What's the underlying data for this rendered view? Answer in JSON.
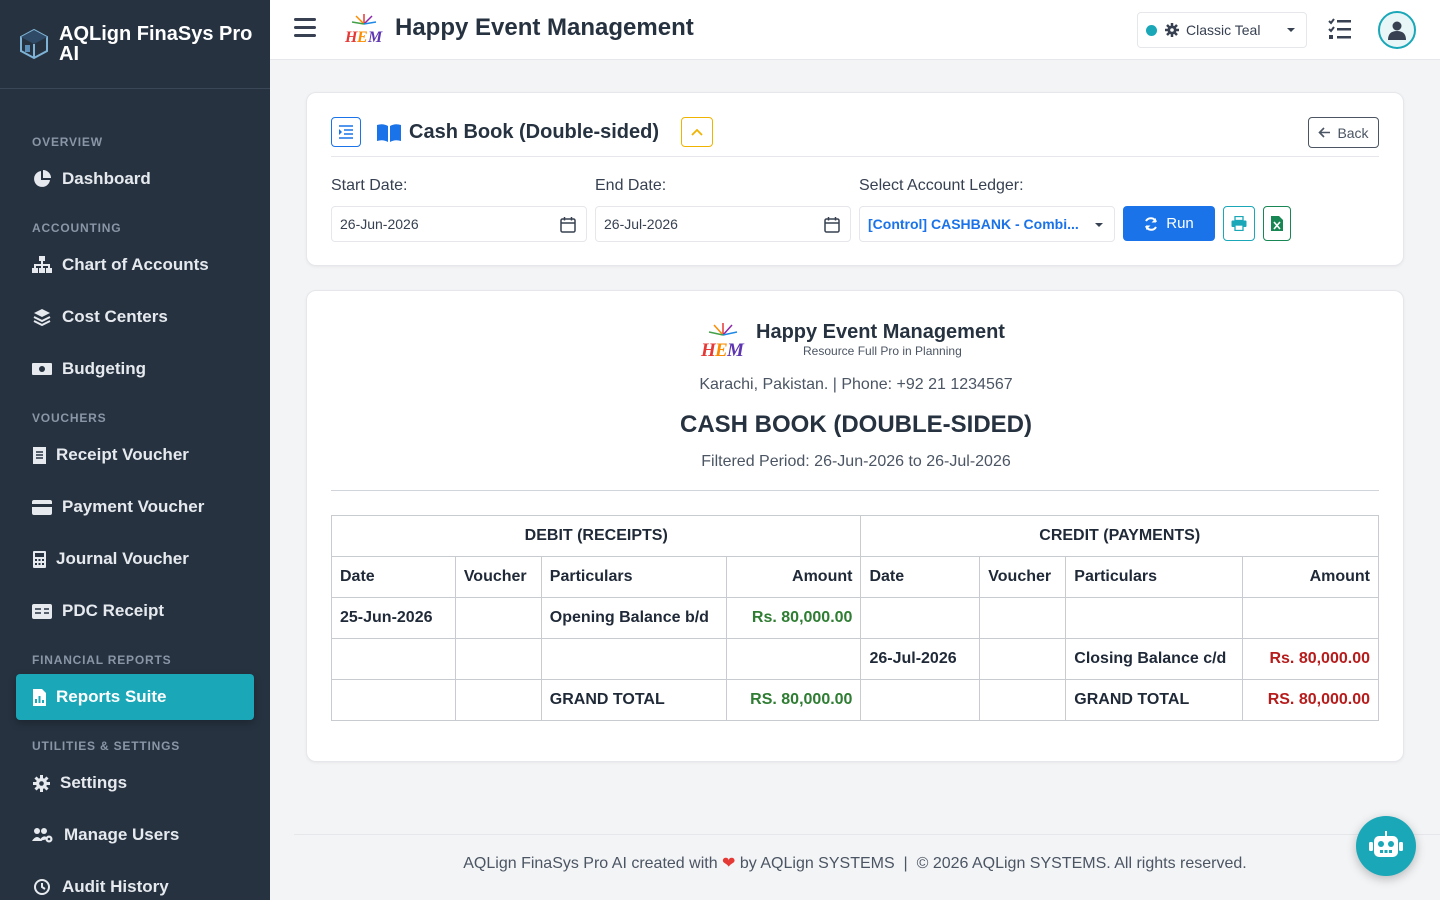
{
  "sidebar": {
    "brand": "AQLign FinaSys Pro AI",
    "sections": {
      "overview": "OVERVIEW",
      "accounting": "ACCOUNTING",
      "vouchers": "VOUCHERS",
      "financial_reports": "FINANCIAL REPORTS",
      "utilities": "UTILITIES & SETTINGS"
    },
    "items": {
      "dashboard": "Dashboard",
      "chart_of_accounts": "Chart of Accounts",
      "cost_centers": "Cost Centers",
      "budgeting": "Budgeting",
      "receipt_voucher": "Receipt Voucher",
      "payment_voucher": "Payment Voucher",
      "journal_voucher": "Journal Voucher",
      "pdc_receipt": "PDC Receipt",
      "reports_suite": "Reports Suite",
      "settings": "Settings",
      "manage_users": "Manage Users",
      "audit_history": "Audit History"
    }
  },
  "header": {
    "title": "Happy Event Management",
    "theme": "Classic Teal",
    "accent_color": "#1aa7b8"
  },
  "filters": {
    "title": "Cash Book (Double-sided)",
    "back_label": "Back",
    "start_label": "Start Date:",
    "start_value": "26-Jun-2026",
    "end_label": "End Date:",
    "end_value": "26-Jul-2026",
    "ledger_label": "Select Account Ledger:",
    "ledger_value": "[Control] CASHBANK - Combi...",
    "run_label": "Run"
  },
  "report": {
    "company": "Happy Event Management",
    "tagline": "Resource Full Pro in Planning",
    "contact": "Karachi, Pakistan. | Phone: +92 21 1234567",
    "title": "CASH BOOK (DOUBLE-SIDED)",
    "period": "Filtered Period: 26-Jun-2026 to 26-Jul-2026",
    "debit_header": "DEBIT (RECEIPTS)",
    "credit_header": "CREDIT (PAYMENTS)",
    "columns": {
      "date": "Date",
      "voucher": "Voucher",
      "particulars": "Particulars",
      "amount": "Amount"
    },
    "rows": [
      {
        "d_date": "25-Jun-2026",
        "d_voucher": "",
        "d_part": "Opening Balance b/d",
        "d_amount": "Rs. 80,000.00",
        "c_date": "",
        "c_voucher": "",
        "c_part": "",
        "c_amount": ""
      },
      {
        "d_date": "",
        "d_voucher": "",
        "d_part": "",
        "d_amount": "",
        "c_date": "26-Jul-2026",
        "c_voucher": "",
        "c_part": "Closing Balance c/d",
        "c_amount": "Rs. 80,000.00"
      }
    ],
    "total": {
      "d_label": "GRAND TOTAL",
      "d_amount": "RS. 80,000.00",
      "c_label": "GRAND TOTAL",
      "c_amount": "RS. 80,000.00"
    }
  },
  "footer": {
    "left": "AQLign FinaSys Pro AI created with",
    "by": "by AQLign SYSTEMS",
    "sep": "|",
    "right": "© 2026 AQLign SYSTEMS. All rights reserved."
  }
}
